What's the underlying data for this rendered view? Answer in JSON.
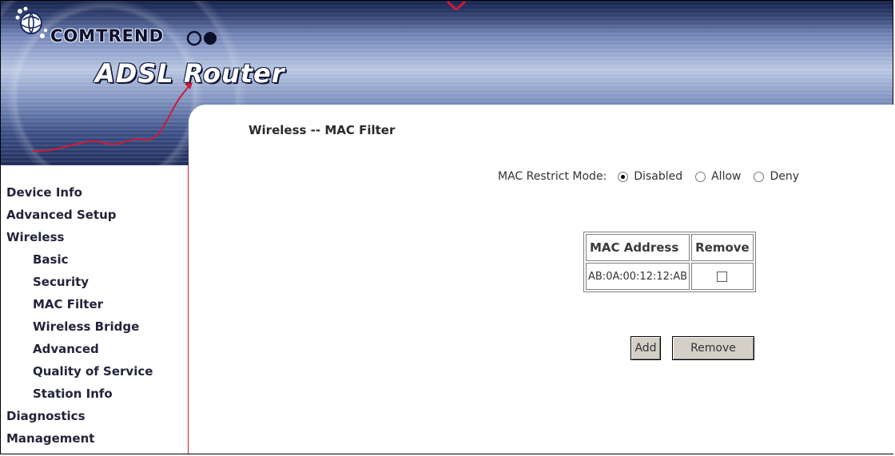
{
  "header": {
    "brand": "COMTREND",
    "product": "ADSL Router"
  },
  "sidebar": {
    "items": [
      {
        "label": "Device Info",
        "level": 0
      },
      {
        "label": "Advanced Setup",
        "level": 0
      },
      {
        "label": "Wireless",
        "level": 0
      },
      {
        "label": "Basic",
        "level": 1
      },
      {
        "label": "Security",
        "level": 1
      },
      {
        "label": "MAC Filter",
        "level": 1
      },
      {
        "label": "Wireless Bridge",
        "level": 1
      },
      {
        "label": "Advanced",
        "level": 1
      },
      {
        "label": "Quality of Service",
        "level": 1
      },
      {
        "label": "Station Info",
        "level": 1
      },
      {
        "label": "Diagnostics",
        "level": 0
      },
      {
        "label": "Management",
        "level": 0
      }
    ]
  },
  "main": {
    "title": "Wireless -- MAC Filter",
    "mode": {
      "label": "MAC Restrict Mode:",
      "options": [
        "Disabled",
        "Allow",
        "Deny"
      ],
      "selected": "Disabled"
    },
    "table": {
      "headers": [
        "MAC Address",
        "Remove"
      ],
      "rows": [
        {
          "mac": "AB:0A:00:12:12:AB",
          "remove_checked": false
        }
      ]
    },
    "buttons": {
      "add": "Add",
      "remove": "Remove"
    }
  },
  "colors": {
    "sidebar_divider": "#d01a3a",
    "banner_dark": "#1f2d5a",
    "button_face": "#d4d0c8"
  }
}
